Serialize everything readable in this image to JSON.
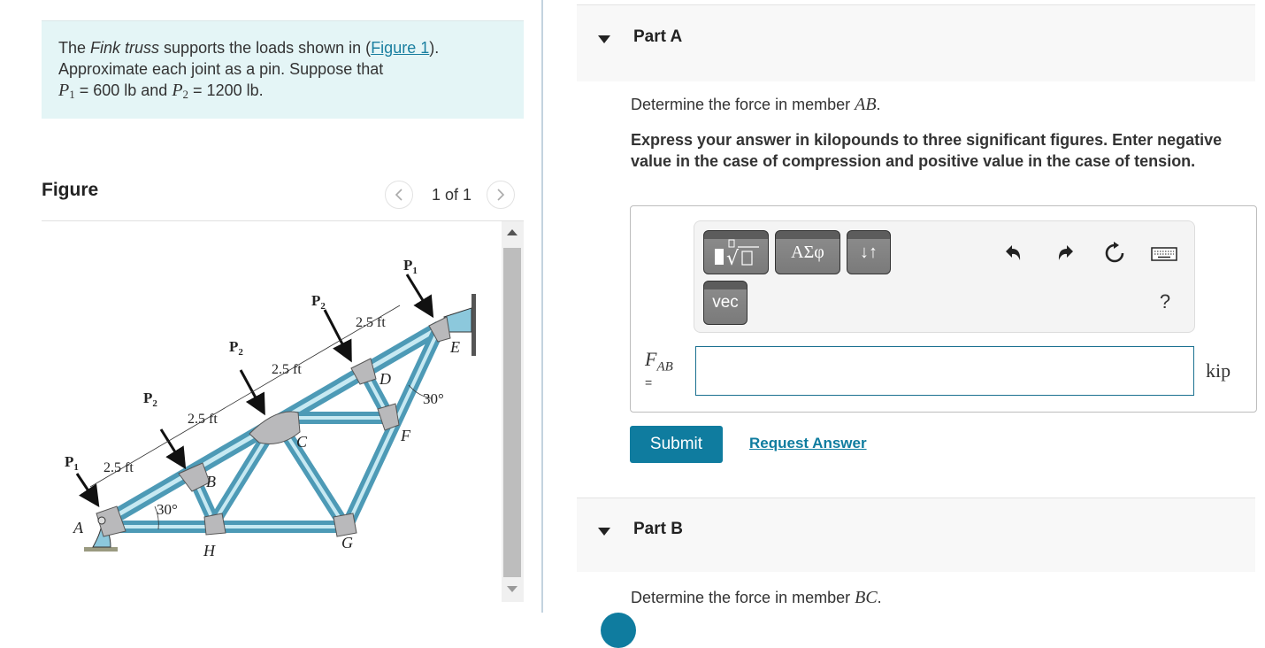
{
  "problem": {
    "text_before": "The ",
    "truss_name": "Fink truss",
    "text_mid": " supports the loads shown in (",
    "figure_link": "Figure 1",
    "text_after": ").",
    "line2": "Approximate each joint as a pin. Suppose that",
    "p1_symbol": "P",
    "p1_sub": "1",
    "p1_value": " = 600 lb",
    "and": " and ",
    "p2_symbol": "P",
    "p2_sub": "2",
    "p2_value": " = 1200 lb."
  },
  "figure": {
    "title": "Figure",
    "counter": "1 of 1",
    "prev_icon": "chevron-left-icon",
    "next_icon": "chevron-right-icon",
    "labels": {
      "P1": "P",
      "P1_sub": "1",
      "P2": "P",
      "P2_sub": "2",
      "dim": "2.5 ft",
      "angle": "30°",
      "joints": [
        "A",
        "B",
        "C",
        "D",
        "E",
        "F",
        "G",
        "H"
      ]
    },
    "colors": {
      "member": "#7cc5dc",
      "member_dark": "#3f8fab",
      "gusset": "#b9b9bb",
      "arrow": "#111111"
    }
  },
  "partA": {
    "title": "Part A",
    "question_prefix": "Determine the force in member ",
    "question_member": "AB",
    "question_suffix": ".",
    "instructions": "Express your answer in kilopounds to three significant figures. Enter negative value in the case of compression and positive value in the case of tension.",
    "toolbar": {
      "templates_icon": "templates-root-icon",
      "greek_label": "ΑΣφ",
      "arrows_label": "↓↑",
      "vec_label": "vec",
      "undo_icon": "undo-icon",
      "redo_icon": "redo-icon",
      "reset_icon": "reset-icon",
      "keyboard_icon": "keyboard-icon",
      "help_label": "?"
    },
    "answer_label": "F",
    "answer_label_sub": "AB",
    "answer_equals": "=",
    "answer_value": "",
    "answer_unit": "kip",
    "submit_label": "Submit",
    "request_label": "Request Answer"
  },
  "partB": {
    "title": "Part B",
    "question_prefix": "Determine the force in member ",
    "question_member": "BC",
    "question_suffix": "."
  },
  "colors": {
    "accent": "#0f7c9f",
    "problem_bg": "#e4f5f6",
    "part_header_bg": "#f8f8f8"
  }
}
